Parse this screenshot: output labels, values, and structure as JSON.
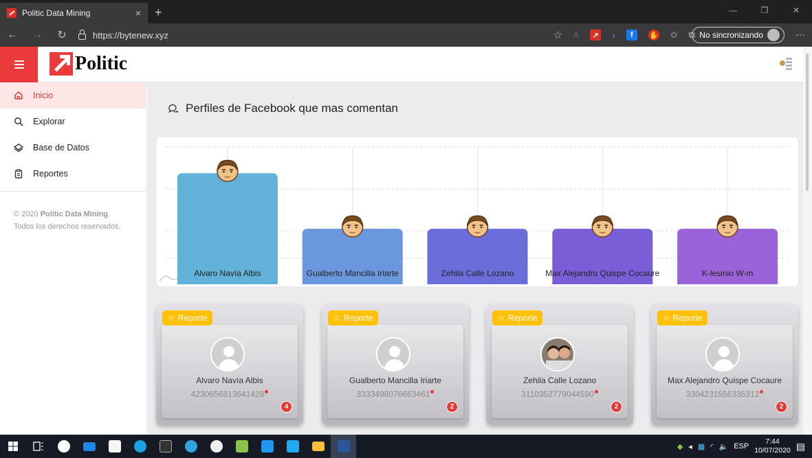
{
  "browser": {
    "tab_title": "Politic Data Mining",
    "tab_close": "×",
    "new_tab": "+",
    "url": "https://bytenew.xyz",
    "sync_label": "No sincronizando",
    "more": "···"
  },
  "app": {
    "logo_text": "Politic"
  },
  "sidebar": {
    "items": [
      {
        "label": "Inicio",
        "icon": "home-icon",
        "active": true
      },
      {
        "label": "Explorar",
        "icon": "search-icon"
      },
      {
        "label": "Base de Datos",
        "icon": "layers-icon"
      },
      {
        "label": "Reportes",
        "icon": "clipboard-icon"
      }
    ],
    "copyright_prefix": "© 2020 ",
    "copyright_brand": "Politic Data Mining",
    "copyright_suffix": ". Todos los derechos reservados."
  },
  "main": {
    "section_title": "Perfiles de Facebook que mas comentan"
  },
  "chart_data": {
    "type": "bar",
    "categories": [
      "Alvaro Navía Albis",
      "Gualberto Mancilla Iriarte",
      "Zehila Calle Lozano",
      "Max Alejandro Quispe Cocaure",
      "K-lesinio W-m"
    ],
    "values": [
      4,
      2,
      2,
      2,
      2
    ],
    "ylim": [
      0,
      4.6
    ],
    "colors": [
      "#62b1d8",
      "#6a97dd",
      "#6b6ddb",
      "#7a5ed8",
      "#9b63d9"
    ],
    "grid": true
  },
  "reports": {
    "badge_label": "Reporte",
    "cards": [
      {
        "name": "Alvaro Navía Albis",
        "id": "4230656813641428",
        "count": "4",
        "photo": "default"
      },
      {
        "name": "Gualberto Mancilla Iriarte",
        "id": "3333498076663461",
        "count": "2",
        "photo": "default"
      },
      {
        "name": "Zehila Calle Lozano",
        "id": "3110352779044590",
        "count": "2",
        "photo": "couple"
      },
      {
        "name": "Max Alejandro Quispe Cocaure",
        "id": "3304231556335312",
        "count": "2",
        "photo": "default"
      }
    ]
  },
  "taskbar": {
    "lang": "ESP",
    "time": "7:44",
    "date": "10/07/2020"
  }
}
